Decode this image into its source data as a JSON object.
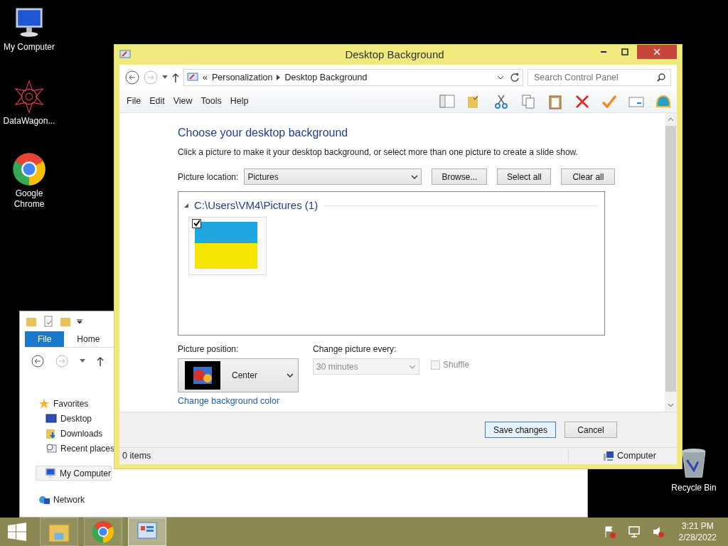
{
  "desktop_icons": [
    {
      "label": "My Computer",
      "kind": "computer"
    },
    {
      "label": "DataWagon...",
      "kind": "star"
    },
    {
      "label": "Google Chrome",
      "kind": "chrome"
    },
    {
      "label": "Recycle Bin",
      "kind": "bin"
    }
  ],
  "explorer_window": {
    "tabs": [
      {
        "label": "File",
        "selected": true
      },
      {
        "label": "Home",
        "selected": false
      }
    ],
    "nav": [
      {
        "label": "Favorites",
        "kind": "star",
        "selected": false,
        "children": [
          {
            "label": "Desktop",
            "kind": "desktop",
            "selected": false
          },
          {
            "label": "Downloads",
            "kind": "downloads",
            "selected": false
          },
          {
            "label": "Recent places",
            "kind": "recent",
            "selected": false
          }
        ]
      },
      {
        "label": "My Computer",
        "kind": "computer",
        "selected": true
      },
      {
        "label": "Network",
        "kind": "network",
        "selected": false
      }
    ]
  },
  "dialog": {
    "title": "Desktop Background",
    "breadcrumb_overflow": "«",
    "breadcrumb": [
      "Personalization",
      "Desktop Background"
    ],
    "search": {
      "placeholder": "Search Control Panel"
    },
    "menu": [
      "File",
      "Edit",
      "View",
      "Tools",
      "Help"
    ],
    "heading": "Choose your desktop background",
    "description": "Click a picture to make it your desktop background, or select more than one picture to create a slide show.",
    "picture_location": {
      "label": "Picture location:",
      "value": "Pictures"
    },
    "location_buttons": [
      "Browse...",
      "Select all",
      "Clear all"
    ],
    "group": {
      "title": "C:\\Users\\VM4\\Pictures (1)",
      "pictures": [
        {
          "checked": true
        }
      ]
    },
    "picture_position": {
      "label": "Picture position:",
      "value": "Center"
    },
    "change_every": {
      "label": "Change picture every:",
      "value": "30 minutes",
      "disabled": true
    },
    "shuffle": {
      "label": "Shuffle",
      "checked": false,
      "disabled": true
    },
    "link": "Change background color",
    "footer_buttons": [
      {
        "label": "Save changes",
        "kind": "default"
      },
      {
        "label": "Cancel",
        "kind": "normal"
      }
    ],
    "status": {
      "items": "0 items",
      "zone": "Computer"
    }
  },
  "taskbar": {
    "apps": [
      {
        "kind": "explorer",
        "selected": false
      },
      {
        "kind": "chrome",
        "selected": false
      },
      {
        "kind": "control",
        "selected": true
      }
    ],
    "time": "3:21 PM",
    "date": "2/28/2022"
  }
}
